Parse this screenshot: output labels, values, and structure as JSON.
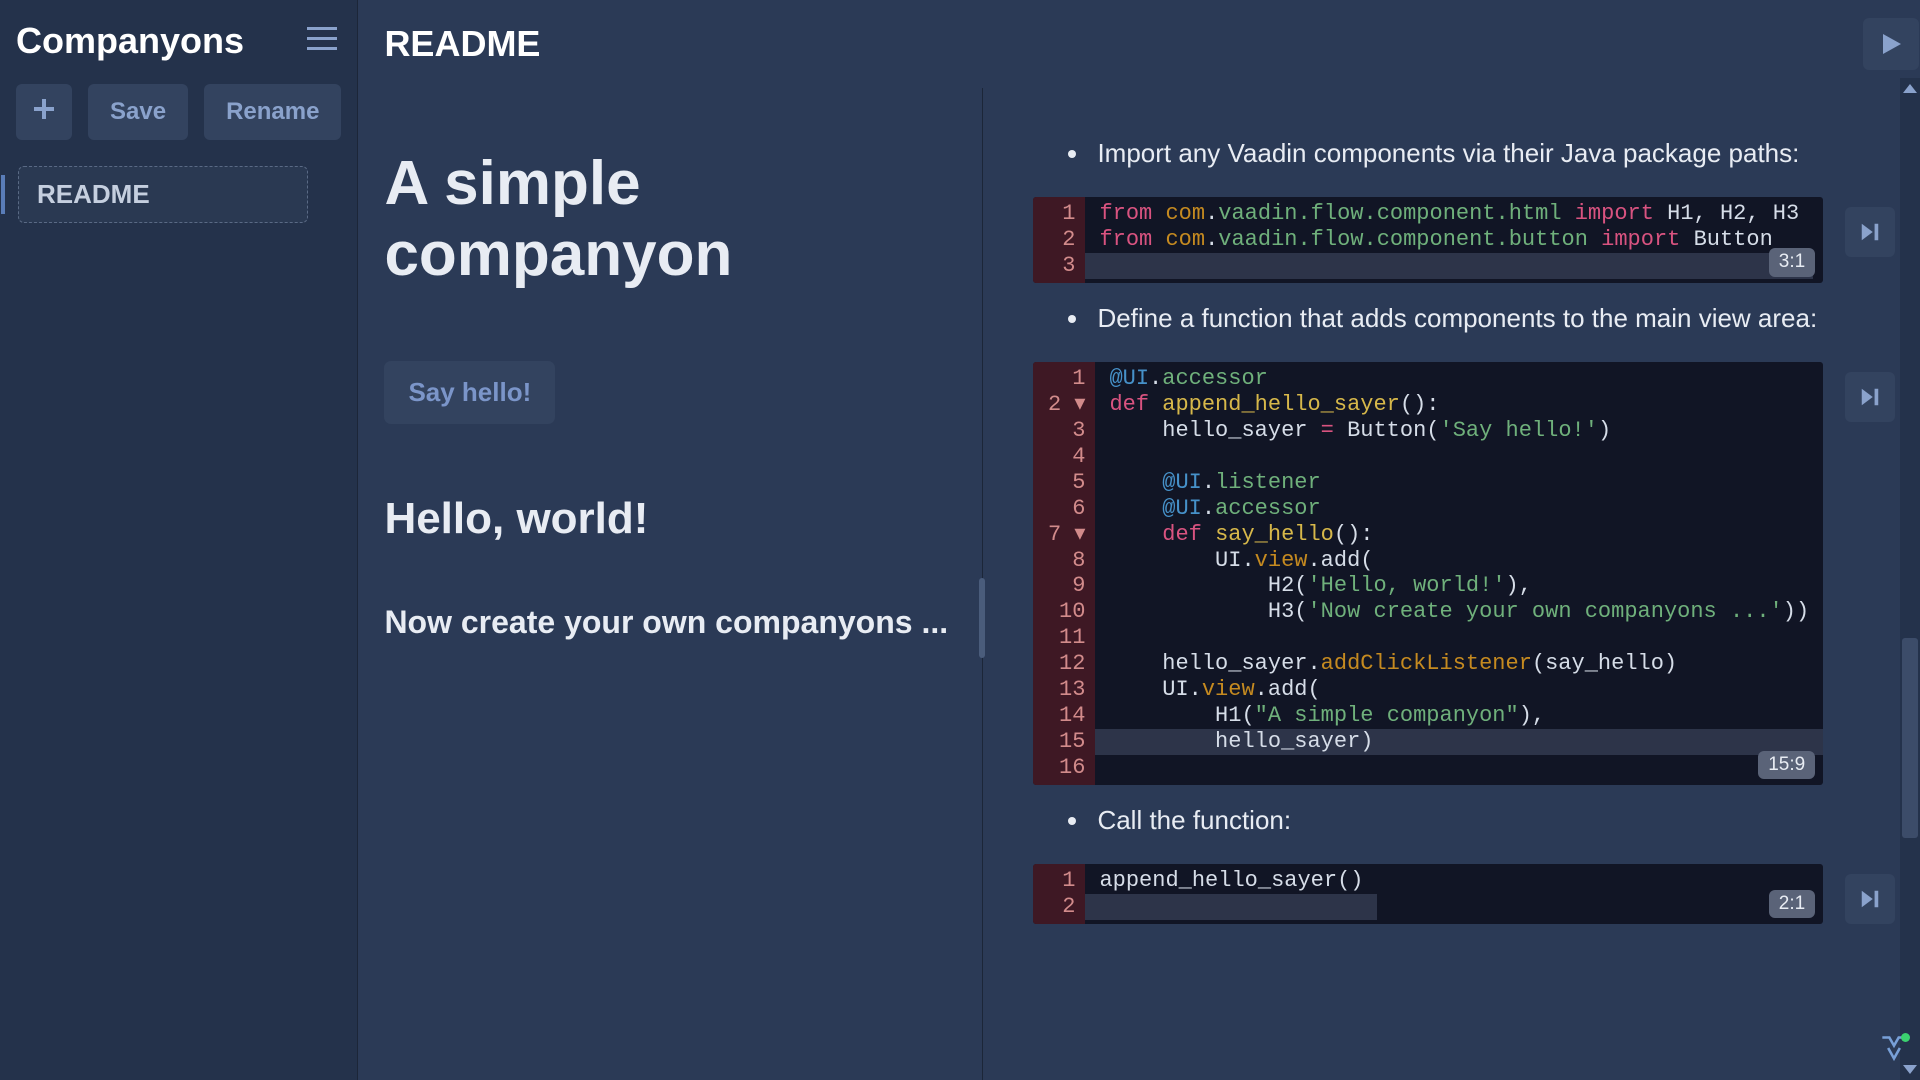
{
  "sidebar": {
    "brand": "Companyons",
    "add_tooltip": "Add",
    "save_label": "Save",
    "rename_label": "Rename",
    "files": [
      "README"
    ]
  },
  "header": {
    "title": "README"
  },
  "preview": {
    "h1": "A simple companyon",
    "button_label": "Say hello!",
    "h2": "Hello, world!",
    "h3": "Now create your own companyons ..."
  },
  "editor": {
    "bullet1": "Import any Vaadin components via their Java package paths:",
    "bullet2": "Define a function that adds components to the main view area:",
    "bullet3": "Call the function:",
    "block1_cursor": "3:1",
    "block2_cursor": "15:9",
    "block3_cursor": "2:1",
    "block1": {
      "lines": [
        {
          "t": [
            {
              "c": "kw",
              "s": "from"
            },
            {
              "c": "",
              "s": " "
            },
            {
              "c": "mod",
              "s": "com"
            },
            {
              "c": "",
              "s": "."
            },
            {
              "c": "pkg",
              "s": "vaadin.flow.component.html"
            },
            {
              "c": "",
              "s": " "
            },
            {
              "c": "kw",
              "s": "import"
            },
            {
              "c": "",
              "s": " "
            },
            {
              "c": "cls",
              "s": "H1, H2, H3"
            }
          ]
        },
        {
          "t": [
            {
              "c": "kw",
              "s": "from"
            },
            {
              "c": "",
              "s": " "
            },
            {
              "c": "mod",
              "s": "com"
            },
            {
              "c": "",
              "s": "."
            },
            {
              "c": "pkg",
              "s": "vaadin.flow.component.button"
            },
            {
              "c": "",
              "s": " "
            },
            {
              "c": "kw",
              "s": "import"
            },
            {
              "c": "",
              "s": " "
            },
            {
              "c": "cls",
              "s": "Button"
            }
          ]
        },
        {
          "hl": true,
          "t": []
        }
      ]
    },
    "block2": {
      "lines": [
        {
          "t": [
            {
              "c": "dec",
              "s": "@UI"
            },
            {
              "c": "",
              "s": "."
            },
            {
              "c": "decp",
              "s": "accessor"
            }
          ]
        },
        {
          "fold": true,
          "t": [
            {
              "c": "kw",
              "s": "def"
            },
            {
              "c": "",
              "s": " "
            },
            {
              "c": "fn",
              "s": "append_hello_sayer"
            },
            {
              "c": "",
              "s": "():"
            }
          ]
        },
        {
          "t": [
            {
              "c": "",
              "s": "    hello_sayer "
            },
            {
              "c": "eq",
              "s": "="
            },
            {
              "c": "",
              "s": " Button("
            },
            {
              "c": "str",
              "s": "'Say hello!'"
            },
            {
              "c": "",
              "s": ")"
            }
          ]
        },
        {
          "t": []
        },
        {
          "t": [
            {
              "c": "",
              "s": "    "
            },
            {
              "c": "dec",
              "s": "@UI"
            },
            {
              "c": "",
              "s": "."
            },
            {
              "c": "decp",
              "s": "listener"
            }
          ]
        },
        {
          "t": [
            {
              "c": "",
              "s": "    "
            },
            {
              "c": "dec",
              "s": "@UI"
            },
            {
              "c": "",
              "s": "."
            },
            {
              "c": "decp",
              "s": "accessor"
            }
          ]
        },
        {
          "fold": true,
          "t": [
            {
              "c": "",
              "s": "    "
            },
            {
              "c": "kw",
              "s": "def"
            },
            {
              "c": "",
              "s": " "
            },
            {
              "c": "fn",
              "s": "say_hello"
            },
            {
              "c": "",
              "s": "():"
            }
          ]
        },
        {
          "t": [
            {
              "c": "",
              "s": "        UI."
            },
            {
              "c": "call",
              "s": "view"
            },
            {
              "c": "",
              "s": ".add("
            }
          ]
        },
        {
          "t": [
            {
              "c": "",
              "s": "            H2("
            },
            {
              "c": "str",
              "s": "'Hello, world!'"
            },
            {
              "c": "",
              "s": "),"
            }
          ]
        },
        {
          "t": [
            {
              "c": "",
              "s": "            H3("
            },
            {
              "c": "str",
              "s": "'Now create your own companyons ...'"
            },
            {
              "c": "",
              "s": "))"
            }
          ]
        },
        {
          "t": []
        },
        {
          "t": [
            {
              "c": "",
              "s": "    hello_sayer."
            },
            {
              "c": "call",
              "s": "addClickListener"
            },
            {
              "c": "",
              "s": "(say_hello)"
            }
          ]
        },
        {
          "t": [
            {
              "c": "",
              "s": "    UI."
            },
            {
              "c": "call",
              "s": "view"
            },
            {
              "c": "",
              "s": ".add("
            }
          ]
        },
        {
          "t": [
            {
              "c": "",
              "s": "        H1("
            },
            {
              "c": "str",
              "s": "\"A simple companyon\""
            },
            {
              "c": "",
              "s": "),"
            }
          ]
        },
        {
          "hl": true,
          "t": [
            {
              "c": "",
              "s": "        hello_sayer)"
            }
          ]
        },
        {
          "t": []
        }
      ]
    },
    "block3": {
      "lines": [
        {
          "t": [
            {
              "c": "",
              "s": "append_hello_sayer()"
            }
          ]
        },
        {
          "hl": true,
          "t": []
        }
      ]
    }
  }
}
